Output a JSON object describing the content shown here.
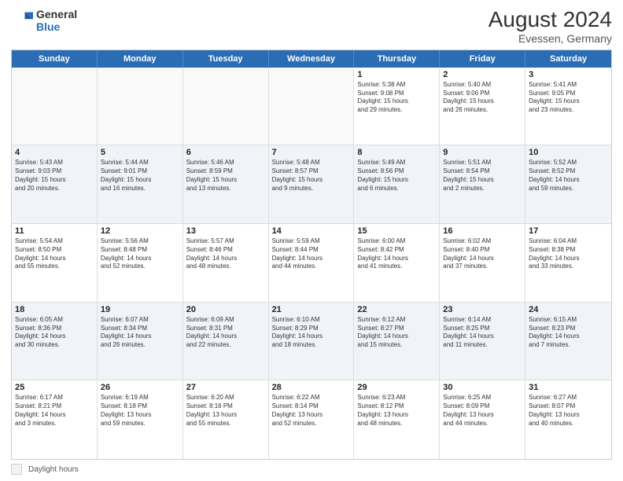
{
  "logo": {
    "general": "General",
    "blue": "Blue"
  },
  "header": {
    "month_year": "August 2024",
    "location": "Evessen, Germany"
  },
  "day_headers": [
    "Sunday",
    "Monday",
    "Tuesday",
    "Wednesday",
    "Thursday",
    "Friday",
    "Saturday"
  ],
  "footer": {
    "legend_label": "Daylight hours"
  },
  "weeks": [
    {
      "days": [
        {
          "date": "",
          "info": "",
          "empty": true
        },
        {
          "date": "",
          "info": "",
          "empty": true
        },
        {
          "date": "",
          "info": "",
          "empty": true
        },
        {
          "date": "",
          "info": "",
          "empty": true
        },
        {
          "date": "1",
          "info": "Sunrise: 5:38 AM\nSunset: 9:08 PM\nDaylight: 15 hours\nand 29 minutes."
        },
        {
          "date": "2",
          "info": "Sunrise: 5:40 AM\nSunset: 9:06 PM\nDaylight: 15 hours\nand 26 minutes."
        },
        {
          "date": "3",
          "info": "Sunrise: 5:41 AM\nSunset: 9:05 PM\nDaylight: 15 hours\nand 23 minutes."
        }
      ]
    },
    {
      "days": [
        {
          "date": "4",
          "info": "Sunrise: 5:43 AM\nSunset: 9:03 PM\nDaylight: 15 hours\nand 20 minutes."
        },
        {
          "date": "5",
          "info": "Sunrise: 5:44 AM\nSunset: 9:01 PM\nDaylight: 15 hours\nand 16 minutes."
        },
        {
          "date": "6",
          "info": "Sunrise: 5:46 AM\nSunset: 8:59 PM\nDaylight: 15 hours\nand 13 minutes."
        },
        {
          "date": "7",
          "info": "Sunrise: 5:48 AM\nSunset: 8:57 PM\nDaylight: 15 hours\nand 9 minutes."
        },
        {
          "date": "8",
          "info": "Sunrise: 5:49 AM\nSunset: 8:56 PM\nDaylight: 15 hours\nand 6 minutes."
        },
        {
          "date": "9",
          "info": "Sunrise: 5:51 AM\nSunset: 8:54 PM\nDaylight: 15 hours\nand 2 minutes."
        },
        {
          "date": "10",
          "info": "Sunrise: 5:52 AM\nSunset: 8:52 PM\nDaylight: 14 hours\nand 59 minutes."
        }
      ]
    },
    {
      "days": [
        {
          "date": "11",
          "info": "Sunrise: 5:54 AM\nSunset: 8:50 PM\nDaylight: 14 hours\nand 55 minutes."
        },
        {
          "date": "12",
          "info": "Sunrise: 5:56 AM\nSunset: 8:48 PM\nDaylight: 14 hours\nand 52 minutes."
        },
        {
          "date": "13",
          "info": "Sunrise: 5:57 AM\nSunset: 8:46 PM\nDaylight: 14 hours\nand 48 minutes."
        },
        {
          "date": "14",
          "info": "Sunrise: 5:59 AM\nSunset: 8:44 PM\nDaylight: 14 hours\nand 44 minutes."
        },
        {
          "date": "15",
          "info": "Sunrise: 6:00 AM\nSunset: 8:42 PM\nDaylight: 14 hours\nand 41 minutes."
        },
        {
          "date": "16",
          "info": "Sunrise: 6:02 AM\nSunset: 8:40 PM\nDaylight: 14 hours\nand 37 minutes."
        },
        {
          "date": "17",
          "info": "Sunrise: 6:04 AM\nSunset: 8:38 PM\nDaylight: 14 hours\nand 33 minutes."
        }
      ]
    },
    {
      "days": [
        {
          "date": "18",
          "info": "Sunrise: 6:05 AM\nSunset: 8:36 PM\nDaylight: 14 hours\nand 30 minutes."
        },
        {
          "date": "19",
          "info": "Sunrise: 6:07 AM\nSunset: 8:34 PM\nDaylight: 14 hours\nand 26 minutes."
        },
        {
          "date": "20",
          "info": "Sunrise: 6:09 AM\nSunset: 8:31 PM\nDaylight: 14 hours\nand 22 minutes."
        },
        {
          "date": "21",
          "info": "Sunrise: 6:10 AM\nSunset: 8:29 PM\nDaylight: 14 hours\nand 18 minutes."
        },
        {
          "date": "22",
          "info": "Sunrise: 6:12 AM\nSunset: 8:27 PM\nDaylight: 14 hours\nand 15 minutes."
        },
        {
          "date": "23",
          "info": "Sunrise: 6:14 AM\nSunset: 8:25 PM\nDaylight: 14 hours\nand 11 minutes."
        },
        {
          "date": "24",
          "info": "Sunrise: 6:15 AM\nSunset: 8:23 PM\nDaylight: 14 hours\nand 7 minutes."
        }
      ]
    },
    {
      "days": [
        {
          "date": "25",
          "info": "Sunrise: 6:17 AM\nSunset: 8:21 PM\nDaylight: 14 hours\nand 3 minutes."
        },
        {
          "date": "26",
          "info": "Sunrise: 6:19 AM\nSunset: 8:18 PM\nDaylight: 13 hours\nand 59 minutes."
        },
        {
          "date": "27",
          "info": "Sunrise: 6:20 AM\nSunset: 8:16 PM\nDaylight: 13 hours\nand 55 minutes."
        },
        {
          "date": "28",
          "info": "Sunrise: 6:22 AM\nSunset: 8:14 PM\nDaylight: 13 hours\nand 52 minutes."
        },
        {
          "date": "29",
          "info": "Sunrise: 6:23 AM\nSunset: 8:12 PM\nDaylight: 13 hours\nand 48 minutes."
        },
        {
          "date": "30",
          "info": "Sunrise: 6:25 AM\nSunset: 8:09 PM\nDaylight: 13 hours\nand 44 minutes."
        },
        {
          "date": "31",
          "info": "Sunrise: 6:27 AM\nSunset: 8:07 PM\nDaylight: 13 hours\nand 40 minutes."
        }
      ]
    }
  ]
}
